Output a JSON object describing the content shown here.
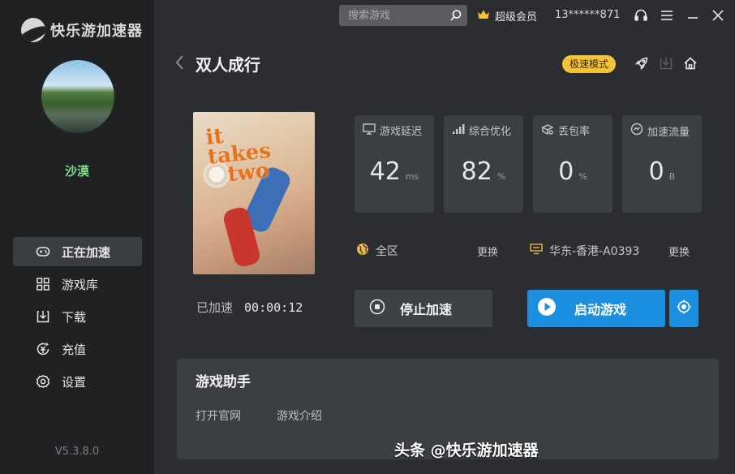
{
  "app": {
    "name": "快乐游加速器",
    "version": "V5.3.8.0"
  },
  "user": {
    "name": "沙漠",
    "vip_label": "超级会员",
    "phone": "13******871"
  },
  "search": {
    "placeholder": "搜索游戏"
  },
  "nav": [
    {
      "label": "正在加速",
      "icon": "gamepad-icon",
      "active": true
    },
    {
      "label": "游戏库",
      "icon": "grid-icon",
      "active": false
    },
    {
      "label": "下载",
      "icon": "download-icon",
      "active": false
    },
    {
      "label": "充值",
      "icon": "recharge-icon",
      "active": false
    },
    {
      "label": "设置",
      "icon": "gear-icon",
      "active": false
    }
  ],
  "game": {
    "title": "双人成行",
    "mode": "极速模式",
    "cover_title_line1": "it",
    "cover_title_line2": "takes",
    "cover_title_line3": "two",
    "elapsed_label": "已加速",
    "elapsed_time": "00:00:12"
  },
  "stats": [
    {
      "label": "游戏延迟",
      "value": "42",
      "unit": "ms",
      "icon": "monitor-icon"
    },
    {
      "label": "综合优化",
      "value": "82",
      "unit": "%",
      "icon": "signal-icon"
    },
    {
      "label": "丢包率",
      "value": "0",
      "unit": "%",
      "icon": "packet-icon"
    },
    {
      "label": "加速流量",
      "value": "0",
      "unit": "B",
      "icon": "traffic-icon"
    }
  ],
  "region": {
    "label": "全区",
    "change": "更换"
  },
  "server": {
    "label": "华东-香港-A0393",
    "change": "更换"
  },
  "actions": {
    "stop": "停止加速",
    "start": "启动游戏"
  },
  "helper": {
    "title": "游戏助手",
    "links": [
      "打开官网",
      "游戏介绍"
    ]
  },
  "watermark": "头条 @快乐游加速器",
  "colors": {
    "accent": "#1d8fe0",
    "badge": "#f3c43a",
    "username": "#7fe08a",
    "sidebar": "#1f2123",
    "main": "#2b2d30"
  }
}
